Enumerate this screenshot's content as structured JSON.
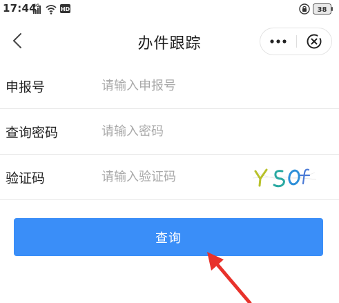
{
  "status_bar": {
    "time": "17:44",
    "network": "4G",
    "hd": "HD",
    "battery": "38"
  },
  "nav": {
    "title": "办件跟踪"
  },
  "form": {
    "rows": [
      {
        "label": "申报号",
        "placeholder": "请输入申报号"
      },
      {
        "label": "查询密码",
        "placeholder": "请输入密码"
      },
      {
        "label": "验证码",
        "placeholder": "请输入验证码"
      }
    ],
    "captcha_text": "YSOf"
  },
  "submit": {
    "label": "查询"
  },
  "colors": {
    "primary": "#3a8ef8",
    "annotation_arrow": "#e8322b"
  }
}
